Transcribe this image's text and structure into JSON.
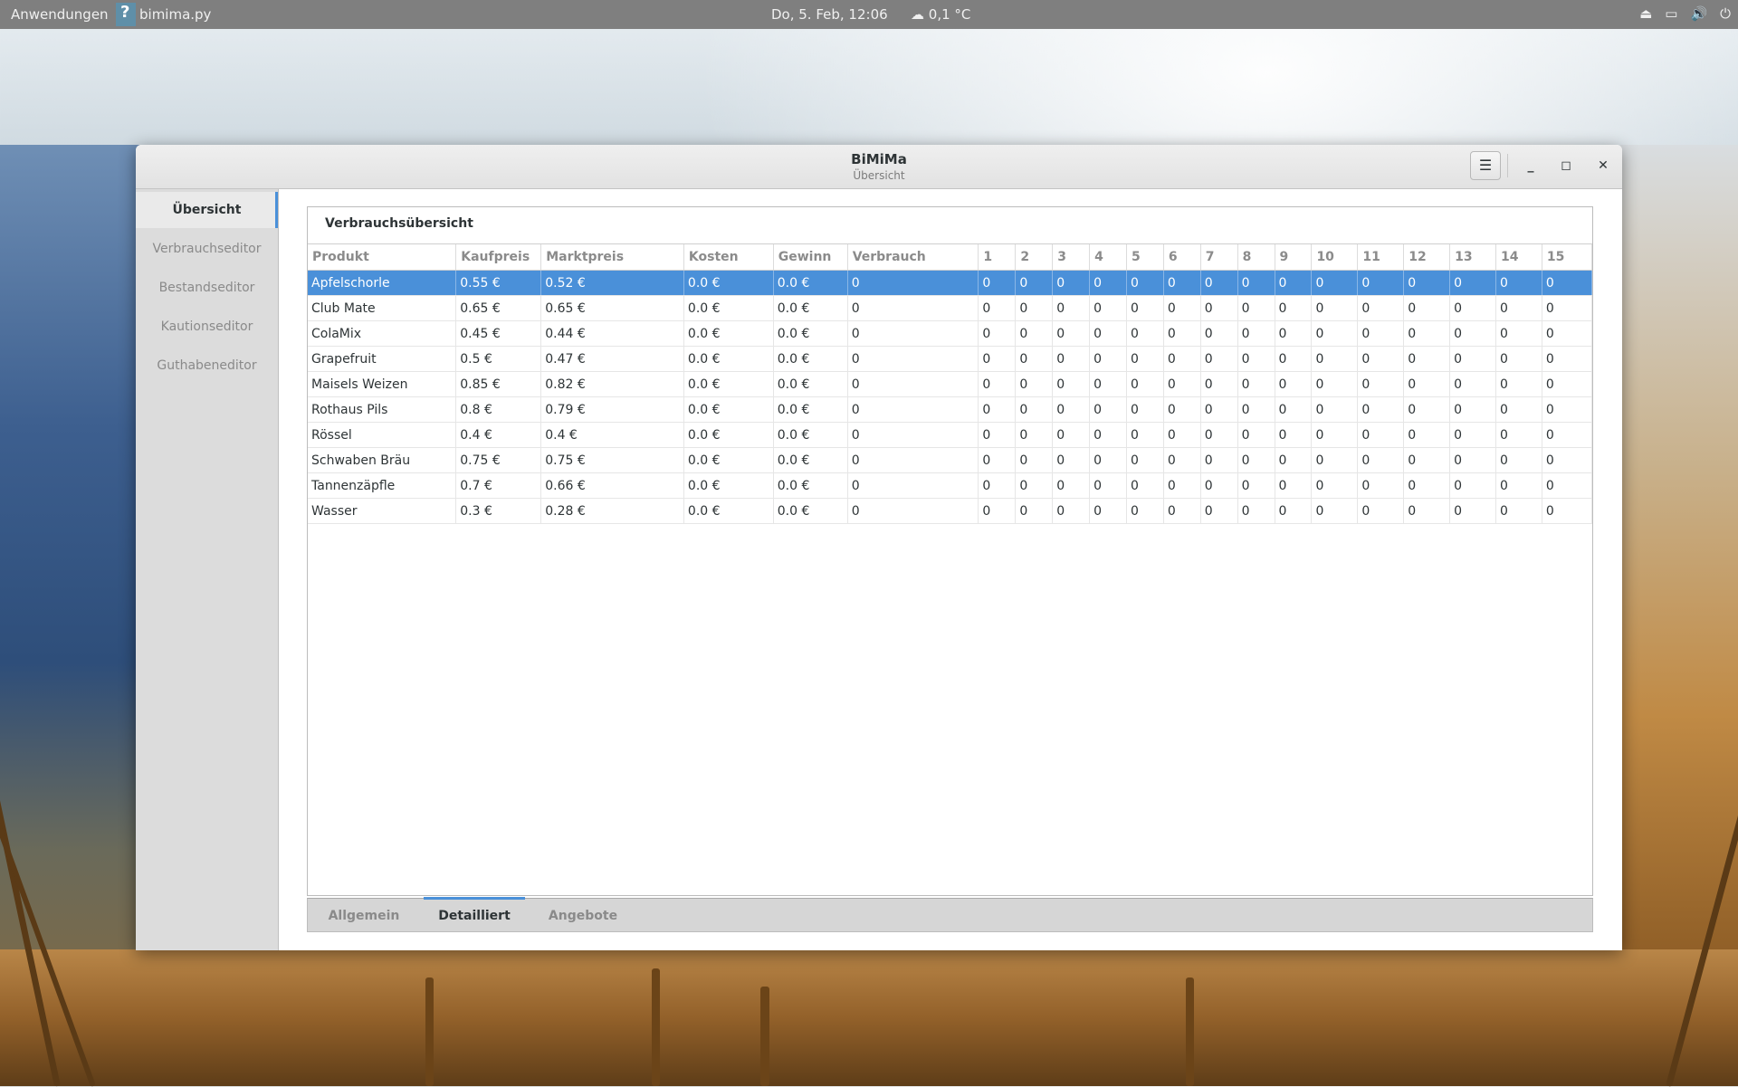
{
  "topbar": {
    "apps_label": "Anwendungen",
    "app_name": "bimima.py",
    "clock": "Do,  5. Feb, 12:06",
    "weather": "0,1 °C"
  },
  "window": {
    "title": "BiMiMa",
    "subtitle": "Übersicht",
    "menu_glyph": "☰",
    "min_glyph": "_",
    "max_glyph": "◻",
    "close_glyph": "✕"
  },
  "sidebar": {
    "items": [
      {
        "label": "Übersicht"
      },
      {
        "label": "Verbrauchseditor"
      },
      {
        "label": "Bestandseditor"
      },
      {
        "label": "Kautionseditor"
      },
      {
        "label": "Guthabeneditor"
      }
    ]
  },
  "main": {
    "section_title": "Verbrauchsübersicht",
    "columns": [
      "Produkt",
      "Kaufpreis",
      "Marktpreis",
      "Kosten",
      "Gewinn",
      "Verbrauch",
      "1",
      "2",
      "3",
      "4",
      "5",
      "6",
      "7",
      "8",
      "9",
      "10",
      "11",
      "12",
      "13",
      "14",
      "15"
    ],
    "rows": [
      [
        "Apfelschorle",
        "0.55 €",
        "0.52 €",
        "0.0 €",
        "0.0 €",
        "0",
        "0",
        "0",
        "0",
        "0",
        "0",
        "0",
        "0",
        "0",
        "0",
        "0",
        "0",
        "0",
        "0",
        "0",
        "0"
      ],
      [
        "Club Mate",
        "0.65 €",
        "0.65 €",
        "0.0 €",
        "0.0 €",
        "0",
        "0",
        "0",
        "0",
        "0",
        "0",
        "0",
        "0",
        "0",
        "0",
        "0",
        "0",
        "0",
        "0",
        "0",
        "0"
      ],
      [
        "ColaMix",
        "0.45 €",
        "0.44 €",
        "0.0 €",
        "0.0 €",
        "0",
        "0",
        "0",
        "0",
        "0",
        "0",
        "0",
        "0",
        "0",
        "0",
        "0",
        "0",
        "0",
        "0",
        "0",
        "0"
      ],
      [
        "Grapefruit",
        "0.5 €",
        "0.47 €",
        "0.0 €",
        "0.0 €",
        "0",
        "0",
        "0",
        "0",
        "0",
        "0",
        "0",
        "0",
        "0",
        "0",
        "0",
        "0",
        "0",
        "0",
        "0",
        "0"
      ],
      [
        "Maisels Weizen",
        "0.85 €",
        "0.82 €",
        "0.0 €",
        "0.0 €",
        "0",
        "0",
        "0",
        "0",
        "0",
        "0",
        "0",
        "0",
        "0",
        "0",
        "0",
        "0",
        "0",
        "0",
        "0",
        "0"
      ],
      [
        "Rothaus Pils",
        "0.8 €",
        "0.79 €",
        "0.0 €",
        "0.0 €",
        "0",
        "0",
        "0",
        "0",
        "0",
        "0",
        "0",
        "0",
        "0",
        "0",
        "0",
        "0",
        "0",
        "0",
        "0",
        "0"
      ],
      [
        "Rössel",
        "0.4 €",
        "0.4 €",
        "0.0 €",
        "0.0 €",
        "0",
        "0",
        "0",
        "0",
        "0",
        "0",
        "0",
        "0",
        "0",
        "0",
        "0",
        "0",
        "0",
        "0",
        "0",
        "0"
      ],
      [
        "Schwaben Bräu",
        "0.75 €",
        "0.75 €",
        "0.0 €",
        "0.0 €",
        "0",
        "0",
        "0",
        "0",
        "0",
        "0",
        "0",
        "0",
        "0",
        "0",
        "0",
        "0",
        "0",
        "0",
        "0",
        "0"
      ],
      [
        "Tannenzäpfle",
        "0.7 €",
        "0.66 €",
        "0.0 €",
        "0.0 €",
        "0",
        "0",
        "0",
        "0",
        "0",
        "0",
        "0",
        "0",
        "0",
        "0",
        "0",
        "0",
        "0",
        "0",
        "0",
        "0"
      ],
      [
        "Wasser",
        "0.3 €",
        "0.28 €",
        "0.0 €",
        "0.0 €",
        "0",
        "0",
        "0",
        "0",
        "0",
        "0",
        "0",
        "0",
        "0",
        "0",
        "0",
        "0",
        "0",
        "0",
        "0",
        "0"
      ]
    ],
    "tabs": [
      {
        "label": "Allgemein"
      },
      {
        "label": "Detailliert"
      },
      {
        "label": "Angebote"
      }
    ]
  }
}
